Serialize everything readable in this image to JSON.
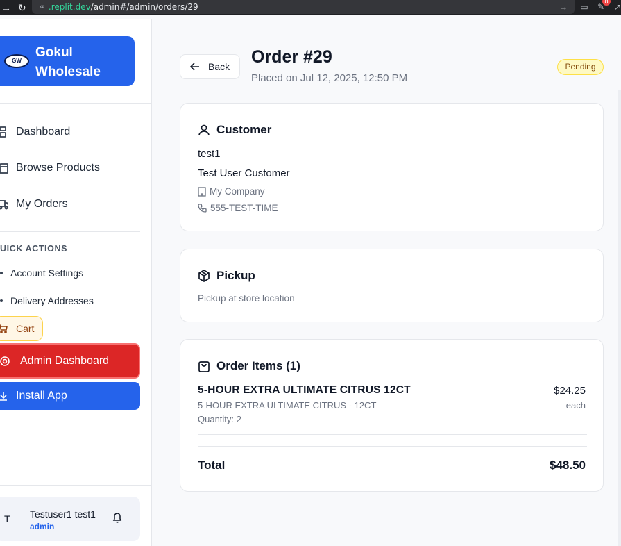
{
  "browser": {
    "url_host": ".replit.dev",
    "url_path": "/admin#/admin/orders/29",
    "ext_badge": "8"
  },
  "sidebar": {
    "brand": "Gokul Wholesale",
    "brand_logo_text": "GW",
    "nav": [
      {
        "label": "Dashboard",
        "icon": "dashboard-icon"
      },
      {
        "label": "Browse Products",
        "icon": "store-icon"
      },
      {
        "label": "My Orders",
        "icon": "truck-icon"
      }
    ],
    "quick_actions_title": "UICK ACTIONS",
    "quick_actions": [
      {
        "label": "Account Settings"
      },
      {
        "label": "Delivery Addresses"
      }
    ],
    "cart_label": "Cart",
    "admin_label": "Admin Dashboard",
    "install_label": "Install App",
    "user": {
      "avatar_initial": "T",
      "name": "Testuser1 test1",
      "role": "admin"
    }
  },
  "header": {
    "back_label": "Back",
    "title": "Order #29",
    "placed": "Placed on Jul 12, 2025, 12:50 PM",
    "status": "Pending"
  },
  "customer": {
    "heading": "Customer",
    "username": "test1",
    "full_name": "Test User Customer",
    "company": "My Company",
    "phone": "555-TEST-TIME"
  },
  "pickup": {
    "heading": "Pickup",
    "text": "Pickup at store location"
  },
  "items": {
    "heading": "Order Items (1)",
    "list": [
      {
        "name": "5-HOUR EXTRA ULTIMATE CITRUS 12CT",
        "sub": "5-HOUR EXTRA ULTIMATE CITRUS - 12CT",
        "qty": "Quantity: 2",
        "price": "$24.25",
        "unit": "each"
      }
    ],
    "total_label": "Total",
    "total_value": "$48.50"
  },
  "colors": {
    "primary": "#2563eb",
    "danger": "#dc2626",
    "pending_bg": "#fef9c3"
  }
}
